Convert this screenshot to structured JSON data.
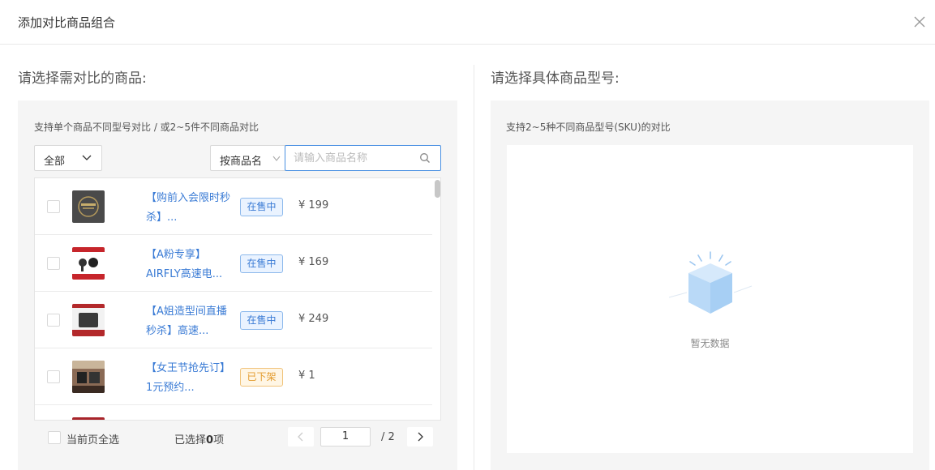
{
  "dialog": {
    "title": "添加对比商品组合"
  },
  "left": {
    "section_title": "请选择需对比的商品:",
    "hint": "支持单个商品不同型号对比 / 或2~5件不同商品对比",
    "filter_select_value": "全部",
    "search_mode_label": "按商品名",
    "search_placeholder": "请输入商品名称",
    "products": [
      {
        "name": "【购前入会限时秒杀】...",
        "status": "在售中",
        "status_type": "on",
        "price": "¥ 199",
        "thumb_color": "#555555"
      },
      {
        "name": "【A粉专享】AIRFLY高速电...",
        "status": "在售中",
        "status_type": "on",
        "price": "¥ 169",
        "thumb_color": "#c6252b"
      },
      {
        "name": "【A姐造型间直播秒杀】高速...",
        "status": "在售中",
        "status_type": "on",
        "price": "¥ 249",
        "thumb_color": "#b3292b"
      },
      {
        "name": "【女王节抢先订】1元预约...",
        "status": "已下架",
        "status_type": "off",
        "price": "¥ 1",
        "thumb_color": "#6b4a3a"
      }
    ],
    "footer": {
      "select_all_label": "当前页全选",
      "selected_prefix": "已选择",
      "selected_count": "0",
      "selected_suffix": "项",
      "page_current": "1",
      "page_total": "/ 2"
    }
  },
  "right": {
    "section_title": "请选择具体商品型号:",
    "hint": "支持2~5种不同商品型号(SKU)的对比",
    "empty_text": "暂无数据"
  },
  "colors": {
    "accent": "#3a7bd5",
    "on_sale": "#3a7bd5",
    "off_shelf": "#e39b2c",
    "panel_bg": "#f5f5f5"
  }
}
